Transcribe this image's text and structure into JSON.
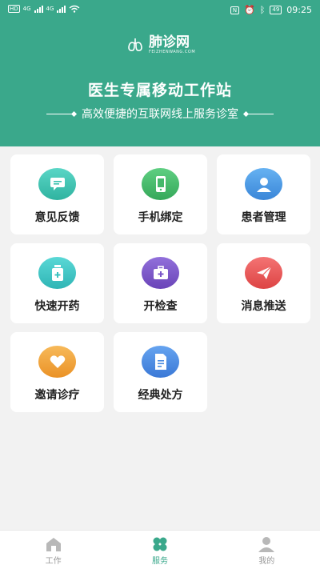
{
  "status": {
    "left_sim1": "HD",
    "left_sim2": "HD",
    "net1": "4G",
    "net2": "4G",
    "battery": "49",
    "time": "09:25"
  },
  "brand": {
    "name": "肺诊网",
    "domain": "FEIZHENWANG.COM"
  },
  "hero": {
    "title": "医生专属移动工作站",
    "subtitle": "高效便捷的互联网线上服务诊室"
  },
  "services": [
    {
      "label": "意见反馈",
      "icon": "chat-icon",
      "color": "#3cc2b0"
    },
    {
      "label": "手机绑定",
      "icon": "phone-icon",
      "color": "#44b86a"
    },
    {
      "label": "患者管理",
      "icon": "user-icon",
      "color": "#4a9be8"
    },
    {
      "label": "快速开药",
      "icon": "medicine-bottle-icon",
      "color": "#3cc2c0"
    },
    {
      "label": "开检查",
      "icon": "medical-kit-icon",
      "color": "#7a55c8"
    },
    {
      "label": "消息推送",
      "icon": "paper-plane-icon",
      "color": "#ee5a5a"
    },
    {
      "label": "邀请诊疗",
      "icon": "heart-icon",
      "color": "#f2a43a"
    },
    {
      "label": "经典处方",
      "icon": "document-icon",
      "color": "#4a8ae0"
    }
  ],
  "tabs": [
    {
      "label": "工作",
      "icon": "home-icon",
      "active": false
    },
    {
      "label": "服务",
      "icon": "clover-icon",
      "active": true
    },
    {
      "label": "我的",
      "icon": "profile-icon",
      "active": false
    }
  ],
  "colors": {
    "primary": "#3aa88b",
    "background": "#f2f2f2"
  }
}
